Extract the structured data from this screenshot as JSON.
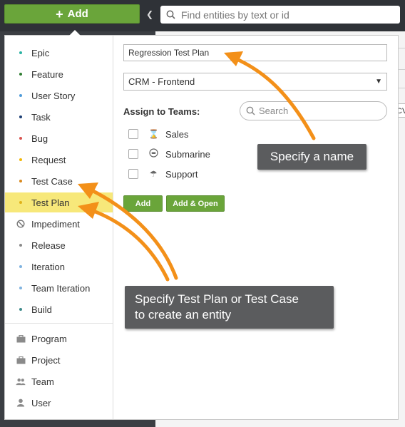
{
  "topbar": {
    "add_label": "Add",
    "search_placeholder": "Find entities by text or id"
  },
  "entity_types": [
    {
      "label": "Epic",
      "color": "#2bb3a3"
    },
    {
      "label": "Feature",
      "color": "#2f7d32"
    },
    {
      "label": "User Story",
      "color": "#4f9bd9"
    },
    {
      "label": "Task",
      "color": "#1c3f74"
    },
    {
      "label": "Bug",
      "color": "#d9534f"
    },
    {
      "label": "Request",
      "color": "#f2b705"
    },
    {
      "label": "Test Case",
      "color": "#d98a1f"
    },
    {
      "label": "Test Plan",
      "color": "#e0b219"
    },
    {
      "label": "Impediment",
      "icon": "ban-icon"
    },
    {
      "label": "Release",
      "color": "#8a8a8a"
    },
    {
      "label": "Iteration",
      "color": "#7fb3e0"
    },
    {
      "label": "Team Iteration",
      "color": "#7fb3e0"
    },
    {
      "label": "Build",
      "color": "#3d8a8a"
    }
  ],
  "other_types": [
    {
      "label": "Program",
      "icon": "briefcase-icon"
    },
    {
      "label": "Project",
      "icon": "briefcase-icon"
    },
    {
      "label": "Team",
      "icon": "team-icon"
    },
    {
      "label": "User",
      "icon": "user-icon"
    }
  ],
  "selected_type": "Test Plan",
  "form": {
    "name_value": "Regression Test Plan",
    "project_value": "CRM - Frontend",
    "assign_label": "Assign to Teams:",
    "team_search_placeholder": "Search",
    "teams": [
      {
        "name": "Sales",
        "icon": "hourglass-icon"
      },
      {
        "name": "Submarine",
        "icon": "submarine-icon"
      },
      {
        "name": "Support",
        "icon": "umbrella-icon"
      }
    ],
    "add_label": "Add",
    "add_open_label": "Add & Open"
  },
  "background_fragment": "CV",
  "annotations": {
    "name_callout": "Specify a name",
    "type_callout_line1": "Specify Test Plan or Test Case",
    "type_callout_line2": "to create an entity",
    "arrow_color": "#f39019"
  }
}
